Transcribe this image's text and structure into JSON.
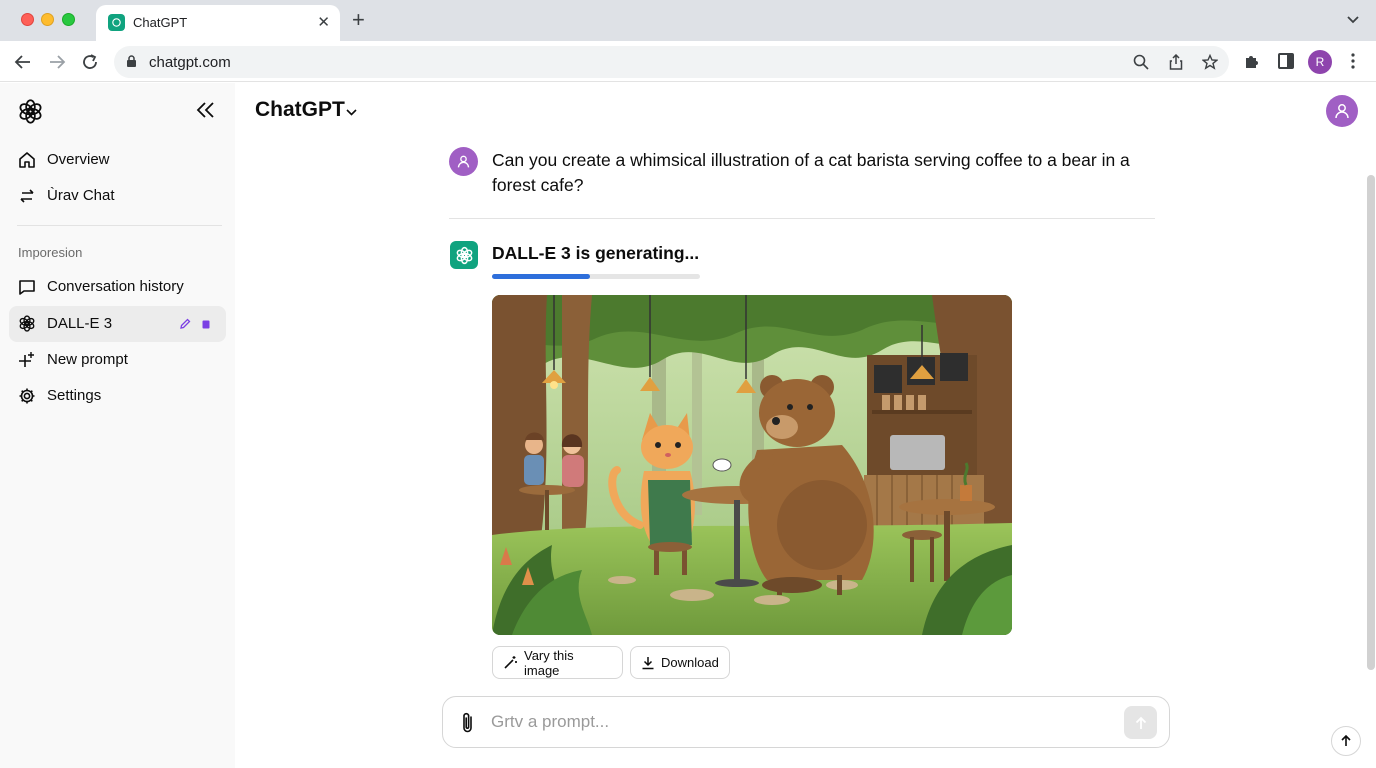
{
  "browser": {
    "tab_title": "ChatGPT",
    "url": "chatgpt.com",
    "profile_initial": "R"
  },
  "sidebar": {
    "items_top": [
      {
        "label": "Overview",
        "icon": "home-icon"
      },
      {
        "label": "Ùrav Chat",
        "icon": "swap-icon"
      }
    ],
    "section_label": "Imporesion",
    "items": [
      {
        "label": "Conversation history",
        "icon": "chat-bubble-icon"
      },
      {
        "label": "DALL-E 3",
        "icon": "openai-logo-icon",
        "active": true
      },
      {
        "label": "New prompt",
        "icon": "new-prompt-icon"
      },
      {
        "label": "Settings",
        "icon": "gear-icon"
      }
    ]
  },
  "header": {
    "title": "ChatGPT"
  },
  "conversation": {
    "user_message": "Can you create a whimsical illustration of a cat barista serving coffee to a bear in a forest cafe?",
    "assistant_status": "DALL-E 3 is generating...",
    "progress": 0.47,
    "buttons": {
      "vary": "Vary this image",
      "download": "Download"
    }
  },
  "composer": {
    "placeholder": "Grtv a prompt..."
  },
  "colors": {
    "accent_green": "#10a37f",
    "avatar_purple": "#a05fc4",
    "progress_blue": "#2e6fdb"
  }
}
